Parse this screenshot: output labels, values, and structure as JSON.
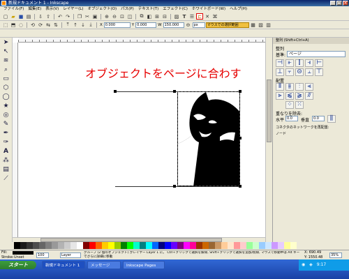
{
  "window": {
    "title": "新規ドキュメント 1 - Inkscape",
    "controls": [
      "_",
      "□",
      "×"
    ]
  },
  "menubar": {
    "items": [
      "ファイル(F)",
      "編集(E)",
      "表示(V)",
      "レイヤー(L)",
      "オブジェクト(O)",
      "パス(P)",
      "テキスト(T)",
      "エフェクト(C)",
      "ホワイトボード(W)",
      "ヘルプ(H)"
    ]
  },
  "toolbar1": {
    "buttons": [
      "new-icon",
      "open-icon",
      "save-icon",
      "print-icon",
      "import-icon",
      "export-icon",
      "undo-icon",
      "redo-icon",
      "copy-icon",
      "cut-icon",
      "paste-icon",
      "zoom-in-icon",
      "zoom-out-icon",
      "zoom-fit-icon",
      "duplicate-icon",
      "clone-icon",
      "group-icon",
      "ungroup-icon",
      "fill-stroke-icon",
      "text-icon",
      "xml-editor-icon",
      "align-icon",
      "preferences-icon"
    ],
    "highlighted": "align-icon"
  },
  "toolbar2": {
    "x_label": "X",
    "x_value": "0.000",
    "y_label": "Y",
    "y_value": "0.000",
    "w_label": "W",
    "w_value": "150.000",
    "units": "px",
    "right_field": "マウスでの選択範囲"
  },
  "annotation": "オブジェクトをページに合わす",
  "dock": {
    "title": "整列 (Shift+Ctrl+A)",
    "align_section": "整列",
    "relative_label": "基準:",
    "relative_value": "ページ",
    "distribute_section": "配置",
    "overlap_section": "重なりを除去:",
    "h_label": "水平",
    "h_value": "0.0",
    "v_label": "垂直",
    "v_value": "0.0",
    "connector_label": "コネクタのネットワークを再配置:",
    "extra_label": "ノード"
  },
  "statusbar": {
    "fill_label": "Fill:",
    "stroke_label": "Stroke:",
    "stroke_value": "Unset",
    "opacity_value": "100",
    "layer_value": "Layer",
    "message": "グループ (2 個のオブジェクト) がレイヤー Layer 1 に。 Ctrl+クリックで選択を解除, Shift+クリックで選択を追加/削除, マウスで移動中は Alt キーでさらに詳細に移動",
    "cursor_x": "X: 690.49",
    "cursor_y": "Y: 1550.48",
    "zoom": "35%"
  },
  "taskbar": {
    "start": "スタート",
    "tasks": [
      "新規ドキュメント 1",
      "メッセージ",
      "Inkscape Pages"
    ],
    "clock": "9:17"
  },
  "palette": [
    "#000000",
    "#1a1a1a",
    "#333333",
    "#4d4d4d",
    "#666666",
    "#808080",
    "#999999",
    "#b3b3b3",
    "#cccccc",
    "#e6e6e6",
    "#ffffff",
    "#800000",
    "#ff0000",
    "#ff6600",
    "#ffcc00",
    "#ffff00",
    "#99cc00",
    "#008000",
    "#00ff00",
    "#00ffcc",
    "#008080",
    "#00ffff",
    "#0066ff",
    "#000080",
    "#0000ff",
    "#6600ff",
    "#800080",
    "#ff00ff",
    "#ff0099",
    "#993300",
    "#cc6600",
    "#996633",
    "#cc9966",
    "#ffcc99",
    "#ffe6cc",
    "#ff9999",
    "#ffcccc",
    "#99ff99",
    "#ccffcc",
    "#99ccff",
    "#cce6ff",
    "#cc99ff",
    "#e6ccff",
    "#ffff99",
    "#ffffcc"
  ]
}
